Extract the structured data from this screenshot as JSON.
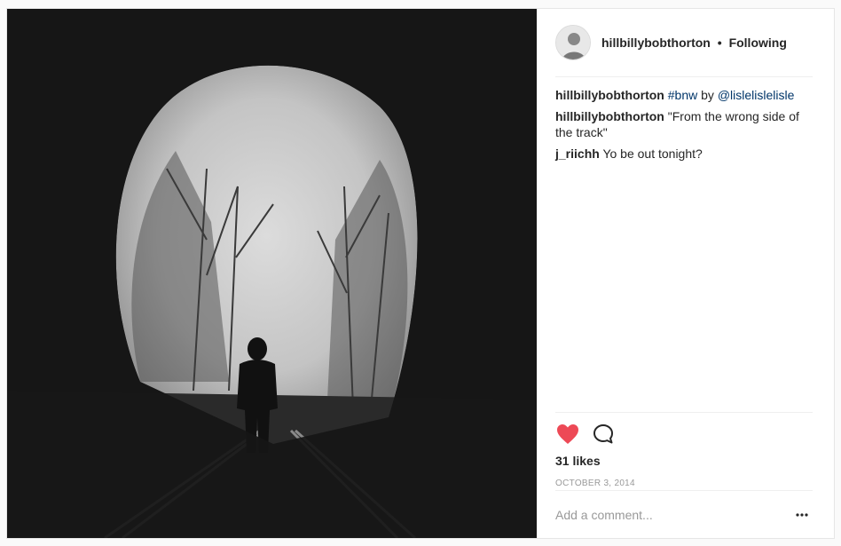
{
  "post": {
    "username": "hillbillybobthorton",
    "separator": "•",
    "follow_status": "Following",
    "comments": [
      {
        "user": "hillbillybobthorton",
        "parts": [
          "#bnw",
          " by ",
          "@lislelislelisle"
        ]
      },
      {
        "user": "hillbillybobthorton",
        "text": "\"From the wrong side of the track\""
      },
      {
        "user": "j_riichh",
        "text": "Yo be out tonight?"
      }
    ],
    "likes": "31 likes",
    "date": "OCTOBER 3, 2014",
    "add_comment_placeholder": "Add a comment...",
    "liked": true
  },
  "colors": {
    "like": "#ed4956",
    "hashtag_link": "#003569",
    "muted": "#999999"
  },
  "icons": [
    "avatar",
    "heart-icon",
    "comment-icon",
    "more-options-icon"
  ]
}
